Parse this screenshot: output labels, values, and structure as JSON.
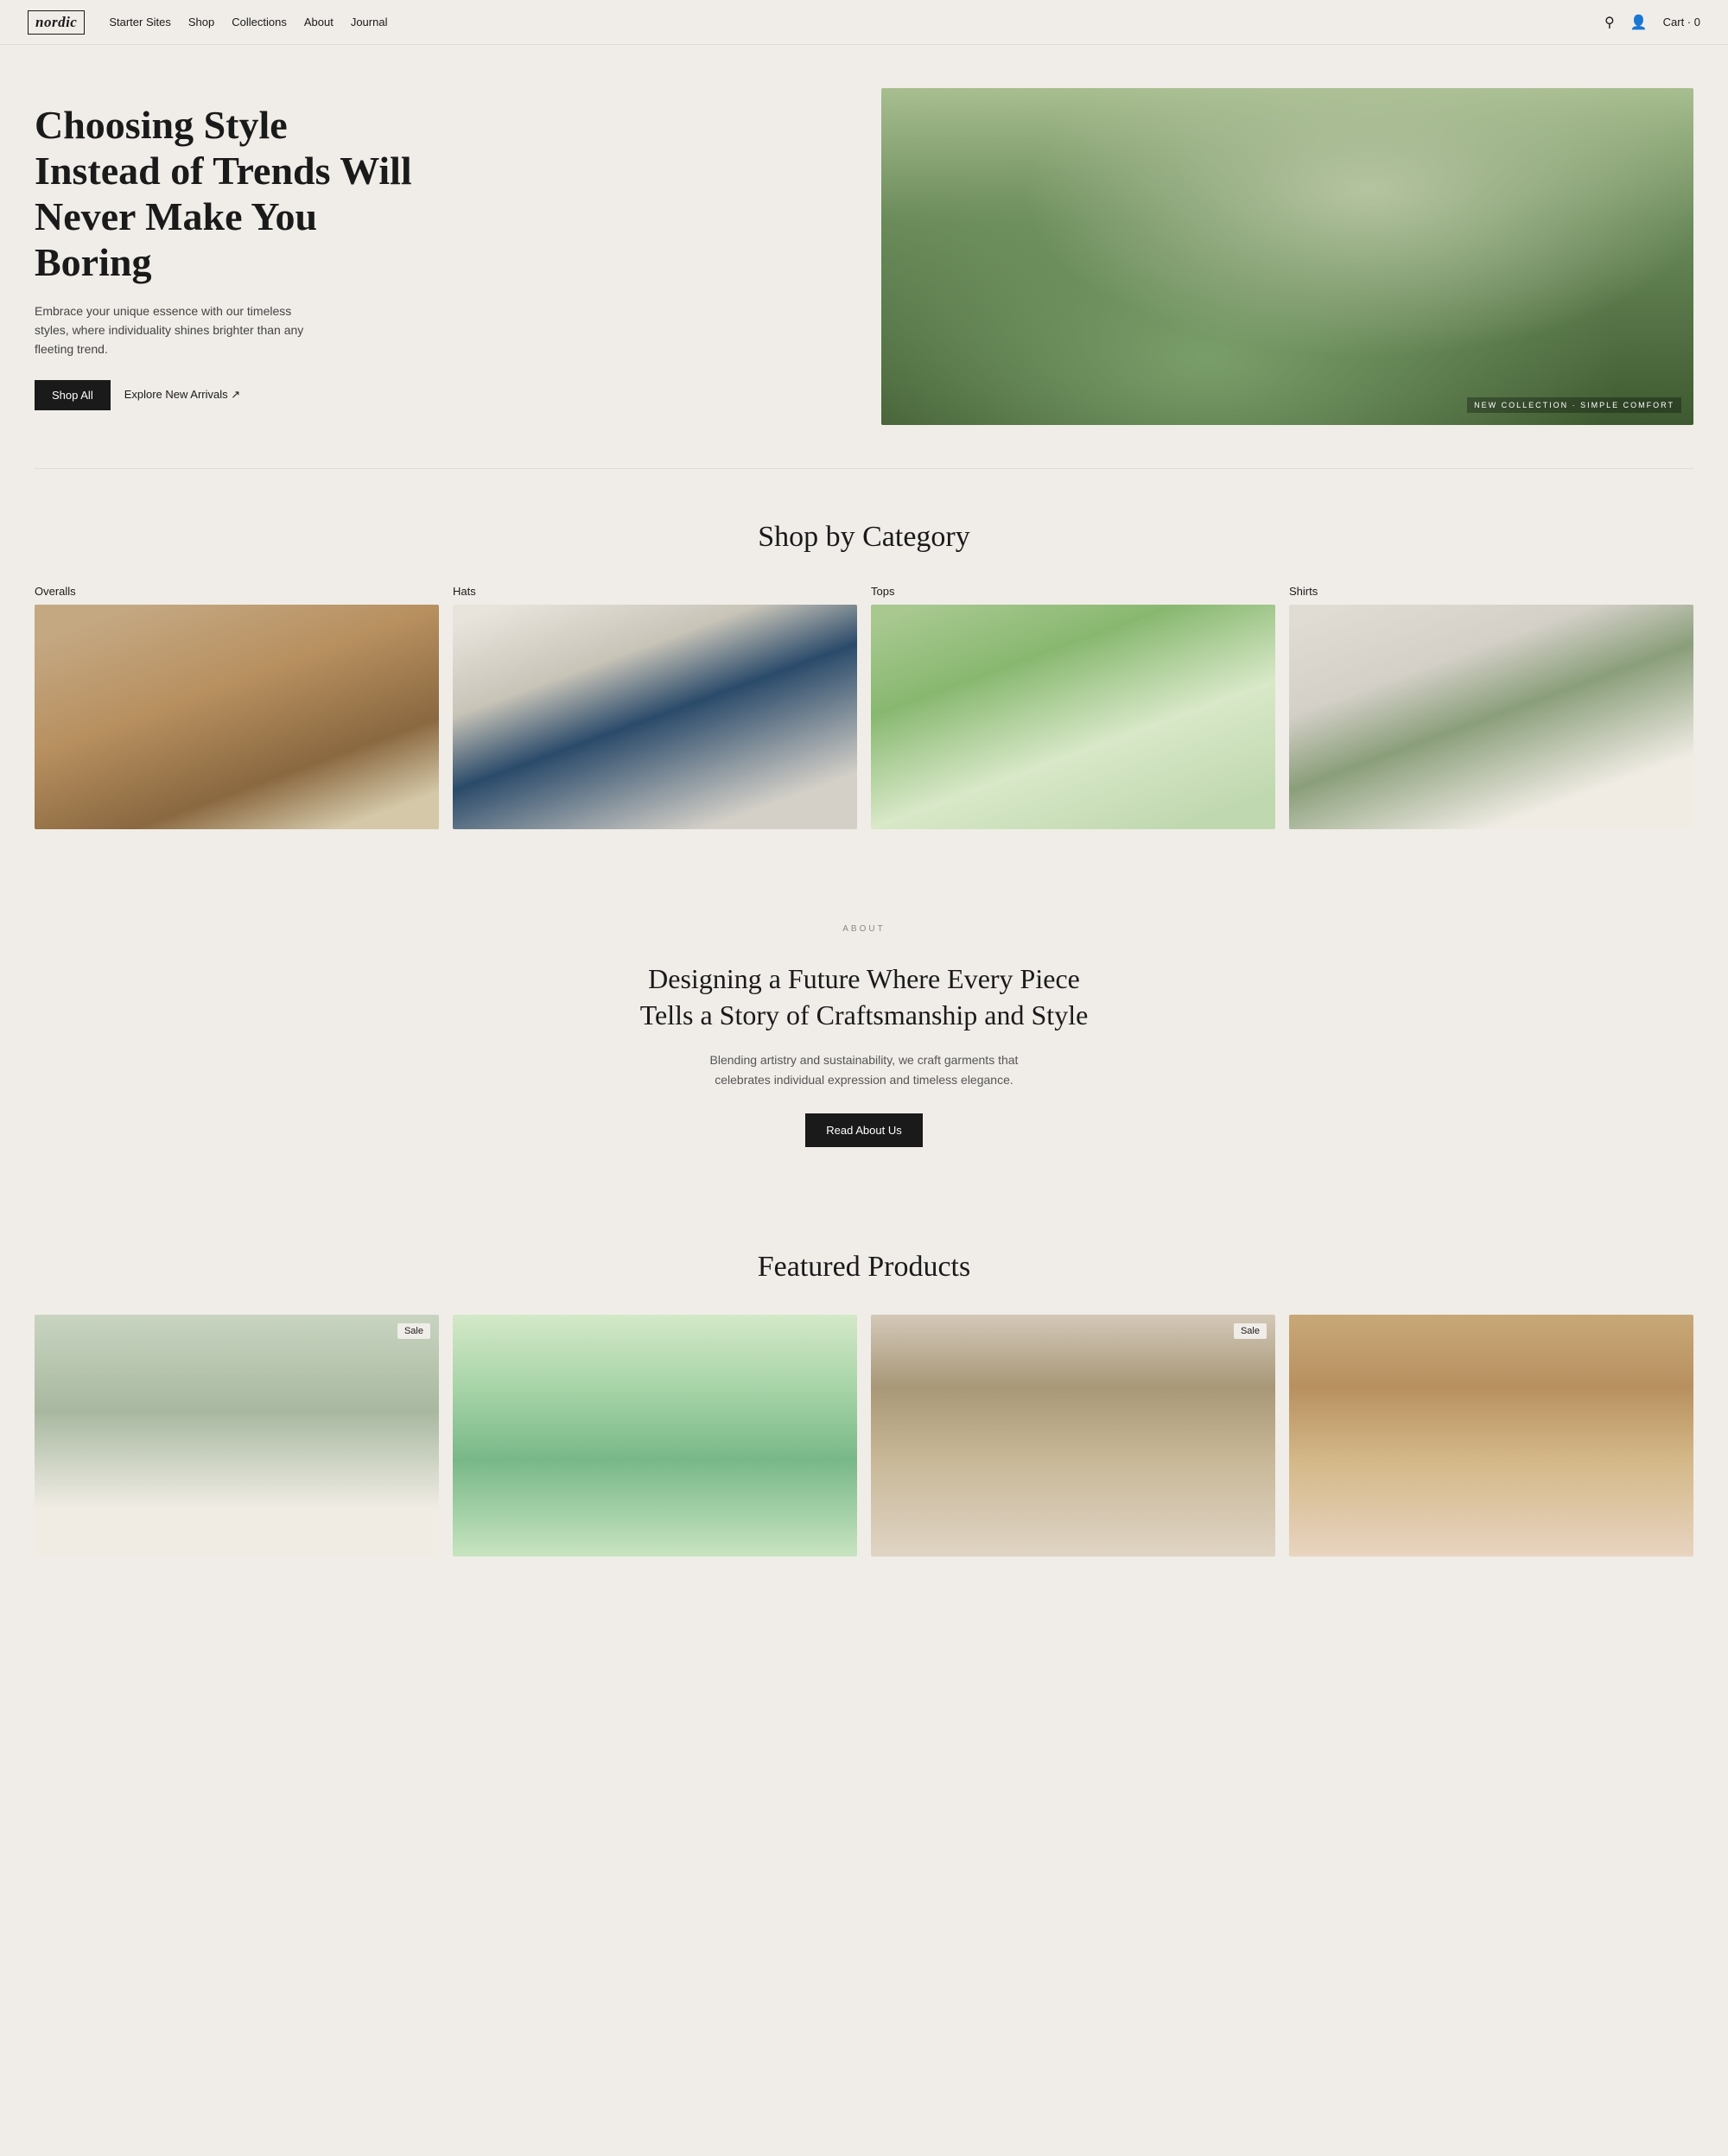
{
  "brand": {
    "name": "nordic"
  },
  "nav": {
    "links": [
      {
        "label": "Starter Sites",
        "href": "#"
      },
      {
        "label": "Shop",
        "href": "#"
      },
      {
        "label": "Collections",
        "href": "#"
      },
      {
        "label": "About",
        "href": "#"
      },
      {
        "label": "Journal",
        "href": "#"
      }
    ],
    "cart_label": "Cart",
    "cart_count": "0"
  },
  "hero": {
    "heading": "Choosing Style Instead of Trends Will Never Make You Boring",
    "subtext": "Embrace your unique essence with our timeless styles, where individuality shines brighter than any fleeting trend.",
    "cta_primary": "Shop All",
    "cta_secondary": "Explore New Arrivals ↗",
    "badge": "NEW COLLECTION · SIMPLE COMFORT"
  },
  "shop_by_category": {
    "title": "Shop by Category",
    "categories": [
      {
        "label": "Overalls",
        "img_class": "cat-overalls"
      },
      {
        "label": "Hats",
        "img_class": "cat-hats"
      },
      {
        "label": "Tops",
        "img_class": "cat-tops"
      },
      {
        "label": "Shirts",
        "img_class": "cat-shirts"
      }
    ]
  },
  "about": {
    "section_label": "ABOUT",
    "title": "Designing a Future Where Every Piece Tells a Story of Craftsmanship and Style",
    "description": "Blending artistry and sustainability, we craft garments that celebrates individual expression and timeless elegance.",
    "cta": "Read About Us"
  },
  "featured_products": {
    "title": "Featured Products",
    "products": [
      {
        "sale": true,
        "img_class": "prod-1"
      },
      {
        "sale": false,
        "img_class": "prod-2"
      },
      {
        "sale": true,
        "img_class": "prod-3"
      },
      {
        "sale": false,
        "img_class": "prod-4"
      }
    ]
  }
}
